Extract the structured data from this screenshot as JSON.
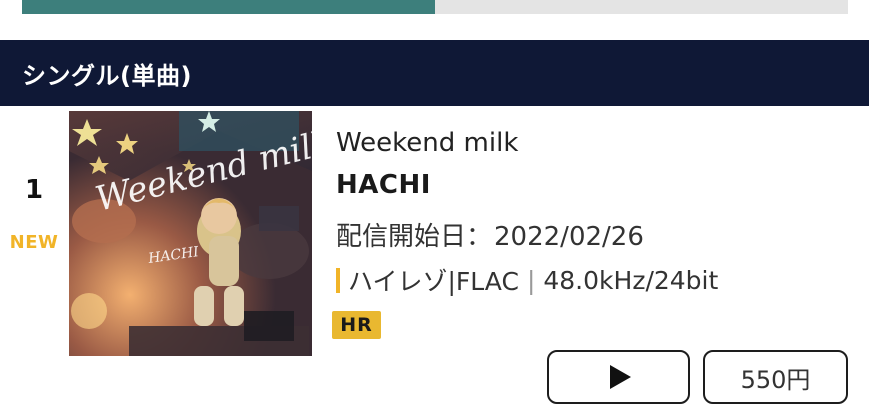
{
  "progress": {
    "fraction": 0.5,
    "fill_color": "#3d7f7c"
  },
  "section": {
    "title": "シングル(単曲)"
  },
  "item": {
    "rank": "1",
    "badge": "NEW",
    "cover_text": {
      "title": "Weekend milk",
      "artist": "HACHI"
    },
    "track_title": "Weekend milk",
    "artist": "HACHI",
    "release_label": "配信開始日：",
    "release_date": "2022/02/26",
    "format_type": "ハイレゾ|FLAC",
    "format_spec": "48.0kHz/24bit",
    "quality_badge": "HR",
    "price": "550円",
    "play_icon": "play-icon"
  },
  "colors": {
    "header_bg": "#0f1836",
    "accent_yellow": "#f1b428"
  }
}
